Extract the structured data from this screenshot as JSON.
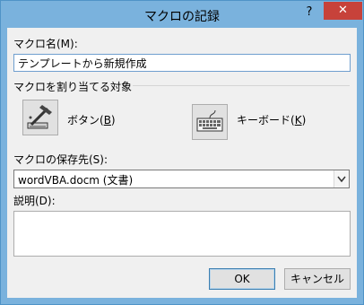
{
  "window": {
    "title": "マクロの記録",
    "help": "?",
    "close": "✕"
  },
  "macro_name": {
    "label": "マクロ名(M):",
    "value": "テンプレートから新規作成"
  },
  "assign": {
    "label": "マクロを割り当てる対象",
    "button_label_prefix": "ボタン(",
    "button_label_key": "B",
    "button_label_suffix": ")",
    "keyboard_label_prefix": "キーボード(",
    "keyboard_label_key": "K",
    "keyboard_label_suffix": ")"
  },
  "store": {
    "label": "マクロの保存先(S):",
    "value": "wordVBA.docm (文書)"
  },
  "description": {
    "label": "説明(D):",
    "value": ""
  },
  "actions": {
    "ok": "OK",
    "cancel": "キャンセル"
  }
}
